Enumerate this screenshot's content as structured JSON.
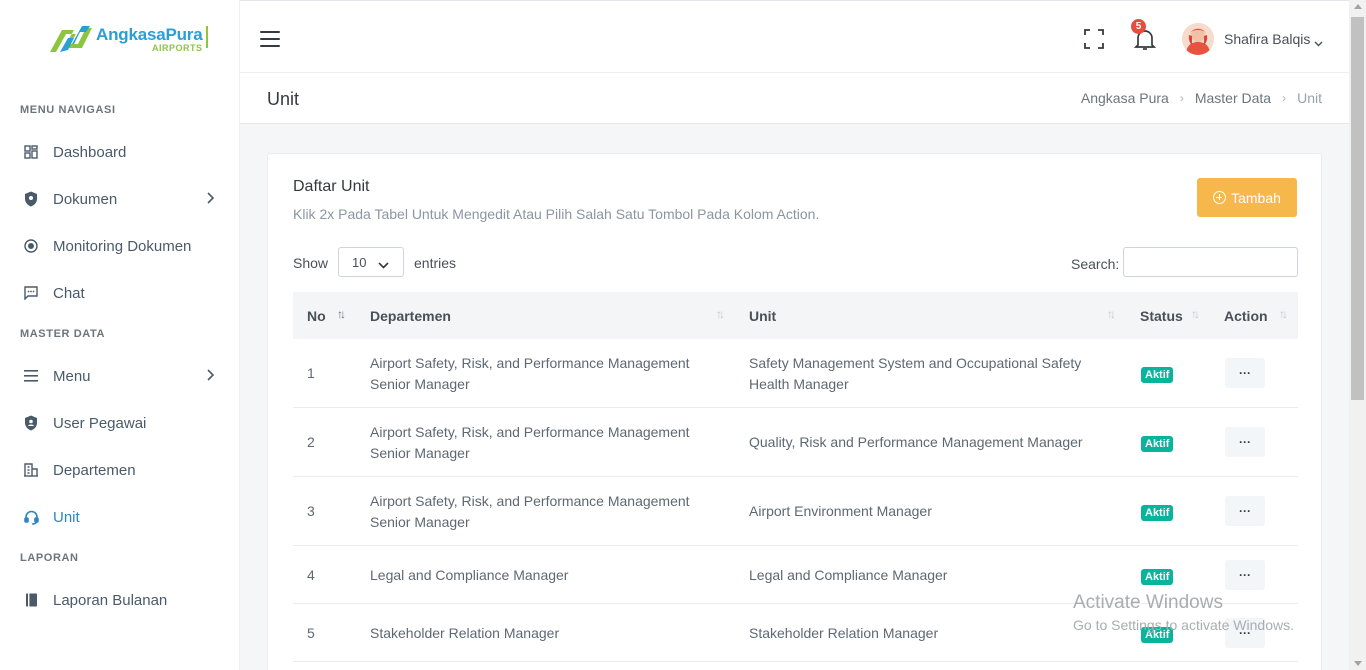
{
  "brand": {
    "name": "AngkasaPura",
    "sub": "AIRPORTS",
    "colors": {
      "blue": "#2a9fd6",
      "green": "#8cc63f"
    }
  },
  "sidebar": {
    "sections": [
      "MENU NAVIGASI",
      "MASTER DATA",
      "LAPORAN"
    ],
    "items": [
      {
        "label": "Dashboard",
        "icon": "dashboard-icon"
      },
      {
        "label": "Dokumen",
        "icon": "shield-icon"
      },
      {
        "label": "Monitoring Dokumen",
        "icon": "target-icon"
      },
      {
        "label": "Chat",
        "icon": "chat-icon"
      },
      {
        "label": "Menu",
        "icon": "list-icon"
      },
      {
        "label": "User Pegawai",
        "icon": "shield-user-icon"
      },
      {
        "label": "Departemen",
        "icon": "building-icon"
      },
      {
        "label": "Unit",
        "icon": "headset-icon"
      },
      {
        "label": "Laporan Bulanan",
        "icon": "book-icon"
      }
    ],
    "active": "Unit"
  },
  "topbar": {
    "notification_count": "5",
    "user_name": "Shafira Balqis"
  },
  "page": {
    "title": "Unit",
    "breadcrumb": [
      "Angkasa Pura",
      "Master Data",
      "Unit"
    ]
  },
  "card": {
    "title": "Daftar Unit",
    "subtitle": "Klik 2x Pada Tabel Untuk Mengedit Atau Pilih Salah Satu Tombol Pada Kolom Action.",
    "add_button": "Tambah",
    "show_label": "Show",
    "show_value": "10",
    "entries_label": "entries",
    "search_label": "Search:",
    "search_value": ""
  },
  "table": {
    "columns": [
      "No",
      "Departemen",
      "Unit",
      "Status",
      "Action"
    ],
    "rows": [
      {
        "no": "1",
        "departemen": [
          "Airport Safety, Risk, and Performance Management",
          "Senior Manager"
        ],
        "unit": [
          "Safety Management System and Occupational Safety",
          "Health Manager"
        ],
        "status": "Aktif",
        "action": "···"
      },
      {
        "no": "2",
        "departemen": [
          "Airport Safety, Risk, and Performance Management",
          "Senior Manager"
        ],
        "unit": [
          "Quality, Risk and Performance Management Manager"
        ],
        "status": "Aktif",
        "action": "···"
      },
      {
        "no": "3",
        "departemen": [
          "Airport Safety, Risk, and Performance Management",
          "Senior Manager"
        ],
        "unit": [
          "Airport Environment Manager"
        ],
        "status": "Aktif",
        "action": "···"
      },
      {
        "no": "4",
        "departemen": [
          "Legal and Compliance Manager"
        ],
        "unit": [
          "Legal and Compliance Manager"
        ],
        "status": "Aktif",
        "action": "···"
      },
      {
        "no": "5",
        "departemen": [
          "Stakeholder Relation Manager"
        ],
        "unit": [
          "Stakeholder Relation Manager"
        ],
        "status": "Aktif",
        "action": "···"
      }
    ],
    "status_color": "#0ab39c"
  },
  "watermark": {
    "line1": "Activate Windows",
    "line2": "Go to Settings to activate Windows."
  }
}
